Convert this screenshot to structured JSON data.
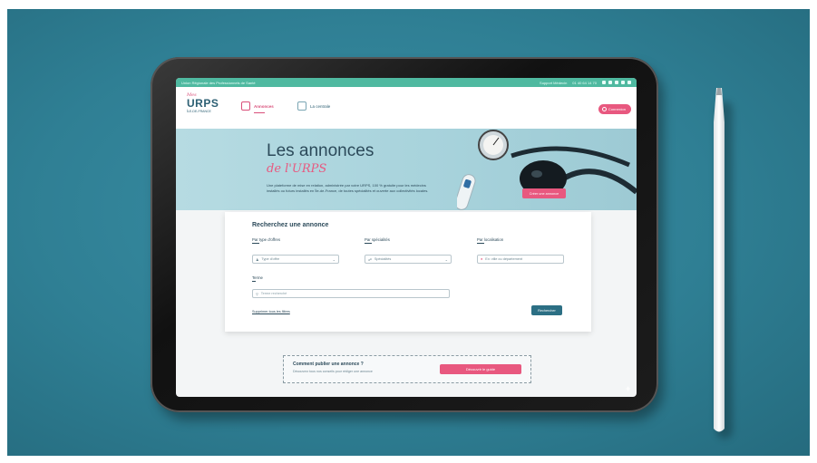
{
  "topbar": {
    "left_text": "Union Régionale des Professionnels de Santé",
    "support_label": "Support Médecin",
    "phone": "01 40 64 14 70"
  },
  "nav": {
    "logo_top": "Mes",
    "logo_main": "URPS",
    "logo_sub": "ÎLE-DE-FRANCE",
    "items": [
      {
        "label": "Annonces",
        "active": true
      },
      {
        "label": "La centrale",
        "active": false
      }
    ],
    "connect_label": "Connexion"
  },
  "hero": {
    "title": "Les annonces",
    "subtitle": "de l'URPS",
    "description": "Une plateforme de mise en relation, administrée par votre URPS, 100 % gratuite pour les médecins installés ou futurs installés en Île-de-France, de toutes spécialités et ouverte aux collectivités locales.",
    "cta_label": "Créer une annonce"
  },
  "search": {
    "heading": "Recherchez une annonce",
    "filters": [
      {
        "label": "Par type d'offres",
        "placeholder": "Type d'offre",
        "icon": "user-icon"
      },
      {
        "label": "Par spécialités",
        "placeholder": "Spécialités",
        "icon": "stethoscope-icon"
      },
      {
        "label": "Par localisation",
        "placeholder": "Ex: ville ou département",
        "icon": "pin-icon"
      }
    ],
    "theme_label": "Terme",
    "theme_placeholder": "Terme recherché",
    "clear_label": "Supprimer tous les filtres",
    "submit_label": "Rechercher"
  },
  "publish": {
    "title": "Comment publier une annonce ?",
    "description": "Découvrez tous nos conseils pour rédiger une annonce",
    "button_label": "Découvrir le guide"
  },
  "colors": {
    "accent": "#e8587f",
    "primary": "#2c6f84",
    "topbar": "#4fb9a0",
    "background": "#2f7f94"
  }
}
